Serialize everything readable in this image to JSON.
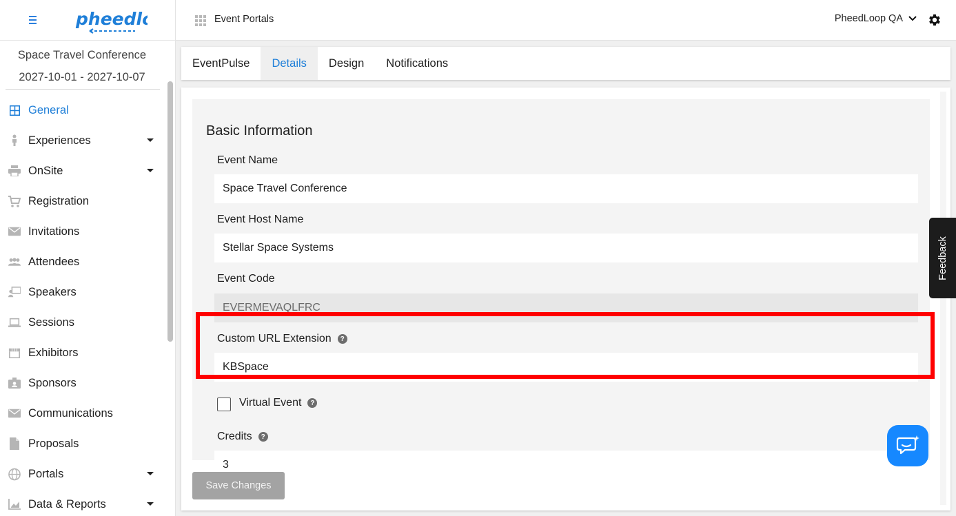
{
  "brand": {
    "logo_text": "pheedloop",
    "accent": "#1f7fd8"
  },
  "event": {
    "name": "Space Travel Conference",
    "dates": "2027-10-01 - 2027-10-07"
  },
  "sidebar": {
    "items": [
      {
        "label": "General",
        "icon": "grid-icon",
        "active": true
      },
      {
        "label": "Experiences",
        "icon": "person-icon",
        "has_submenu": true
      },
      {
        "label": "OnSite",
        "icon": "printer-icon",
        "has_submenu": true
      },
      {
        "label": "Registration",
        "icon": "cart-icon"
      },
      {
        "label": "Invitations",
        "icon": "envelope-icon"
      },
      {
        "label": "Attendees",
        "icon": "people-icon"
      },
      {
        "label": "Speakers",
        "icon": "presenter-icon"
      },
      {
        "label": "Sessions",
        "icon": "laptop-icon"
      },
      {
        "label": "Exhibitors",
        "icon": "storefront-icon"
      },
      {
        "label": "Sponsors",
        "icon": "badge-icon"
      },
      {
        "label": "Communications",
        "icon": "envelope-icon"
      },
      {
        "label": "Proposals",
        "icon": "document-icon"
      },
      {
        "label": "Portals",
        "icon": "globe-icon",
        "has_submenu": true
      },
      {
        "label": "Data & Reports",
        "icon": "chart-icon",
        "has_submenu": true
      }
    ]
  },
  "topbar": {
    "title": "Event Portals",
    "account": "PheedLoop QA"
  },
  "tabs": [
    {
      "label": "EventPulse"
    },
    {
      "label": "Details",
      "active": true
    },
    {
      "label": "Design"
    },
    {
      "label": "Notifications"
    }
  ],
  "form": {
    "section_title": "Basic Information",
    "event_name": {
      "label": "Event Name",
      "value": "Space Travel Conference"
    },
    "host_name": {
      "label": "Event Host Name",
      "value": "Stellar Space Systems"
    },
    "event_code": {
      "label": "Event Code",
      "value": "EVERMEVAQLFRC"
    },
    "custom_url": {
      "label": "Custom URL Extension",
      "value": "KBSpace"
    },
    "virtual_event": {
      "label": "Virtual Event",
      "checked": false
    },
    "credits": {
      "label": "Credits",
      "value": "3"
    },
    "save_label": "Save Changes"
  },
  "feedback_label": "Feedback"
}
